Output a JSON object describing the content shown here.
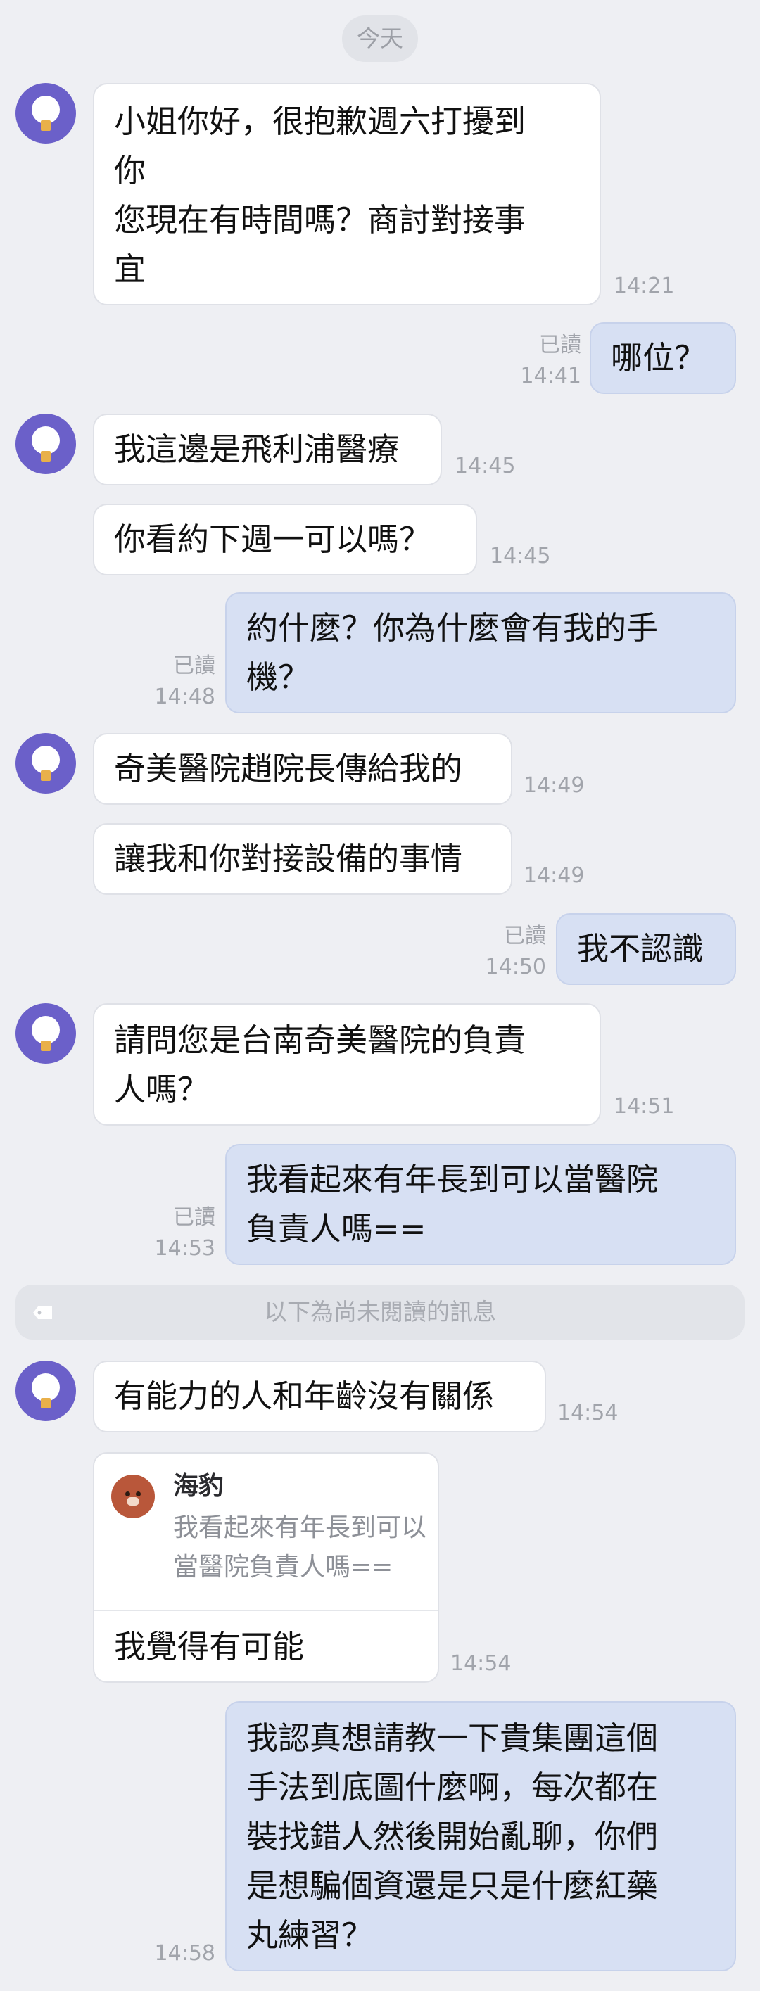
{
  "date_label": "今天",
  "unread_divider": "以下為尚未閱讀的訊息",
  "messages": [
    {
      "text": "小姐你好，很抱歉週六打擾到\n你\n您現在有時間嗎？商討對接事\n宜",
      "time": "14:21"
    },
    {
      "text": "哪位？",
      "read": "已讀",
      "time": "14:41"
    },
    {
      "text": "我這邊是飛利浦醫療",
      "time": "14:45"
    },
    {
      "text": "你看約下週一可以嗎？",
      "time": "14:45"
    },
    {
      "text": "約什麼？你為什麼會有我的手\n機？",
      "read": "已讀",
      "time": "14:48"
    },
    {
      "text": "奇美醫院趙院長傳給我的",
      "time": "14:49"
    },
    {
      "text": "讓我和你對接設備的事情",
      "time": "14:49"
    },
    {
      "text": "我不認識",
      "read": "已讀",
      "time": "14:50"
    },
    {
      "text": "請問您是台南奇美醫院的負責\n人嗎？",
      "time": "14:51"
    },
    {
      "text": "我看起來有年長到可以當醫院\n負責人嗎==",
      "read": "已讀",
      "time": "14:53"
    },
    {
      "text": "有能力的人和年齡沒有關係",
      "time": "14:54"
    },
    {
      "text": "我認真想請教一下貴集團這個\n手法到底圖什麼啊，每次都在\n裝找錯人然後開始亂聊，你們\n是想騙個資還是只是什麼紅藥\n丸練習？",
      "time": "14:58"
    }
  ],
  "reply": {
    "quoted_name": "海豹",
    "quoted_text": "我看起來有年長到可以當醫院負責人嗎==",
    "text": "我覺得有可能",
    "time": "14:54"
  },
  "colors": {
    "background": "#eeeff3",
    "incoming_bubble": "#ffffff",
    "outgoing_bubble": "#d7e0f3",
    "avatar": "#6b60c9"
  }
}
